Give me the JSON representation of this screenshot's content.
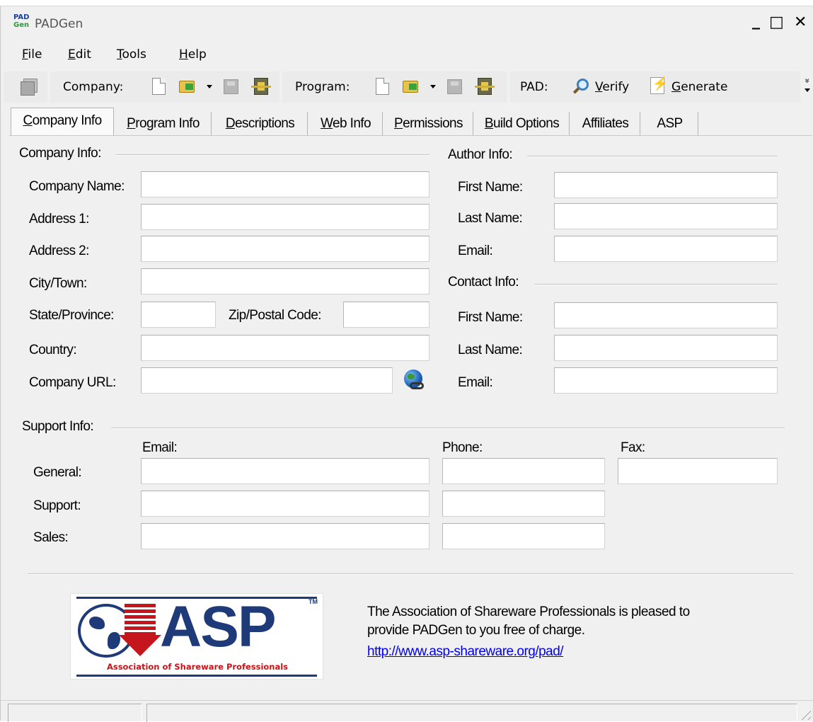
{
  "window": {
    "title": "PADGen",
    "app_icon_top": "PAD",
    "app_icon_bottom": "Gen",
    "minimize": "_",
    "maximize": "□",
    "close": "✕"
  },
  "menu": {
    "file": {
      "key": "F",
      "rest": "ile"
    },
    "edit": {
      "key": "E",
      "rest": "dit"
    },
    "tools": {
      "key": "T",
      "rest": "ools"
    },
    "help": {
      "key": "H",
      "rest": "elp"
    }
  },
  "toolbar": {
    "company_label": "Company:",
    "program_label": "Program:",
    "pad_label": "PAD:",
    "verify": {
      "key": "V",
      "rest": "erify"
    },
    "generate": {
      "key": "G",
      "rest": "enerate"
    },
    "overflow": "»"
  },
  "tabs": [
    {
      "key": "C",
      "rest": "ompany Info",
      "active": true
    },
    {
      "key": "P",
      "rest": "rogram Info"
    },
    {
      "key": "D",
      "rest": "escriptions"
    },
    {
      "key": "W",
      "rest": "eb Info"
    },
    {
      "key": "P",
      "rest": "ermissions"
    },
    {
      "key": "B",
      "rest": "uild Options"
    },
    {
      "key": "",
      "rest": "Affiliates"
    },
    {
      "key": "",
      "rest": "ASP"
    }
  ],
  "company": {
    "group_label": "Company Info:",
    "name_label": "Company Name:",
    "address1_label": "Address 1:",
    "address2_label": "Address 2:",
    "city_label": "City/Town:",
    "state_label": "State/Province:",
    "zip_label": "Zip/Postal Code:",
    "country_label": "Country:",
    "url_label": "Company URL:",
    "name": "",
    "address1": "",
    "address2": "",
    "city": "",
    "state": "",
    "zip": "",
    "country": "",
    "url": ""
  },
  "author": {
    "group_label": "Author Info:",
    "first_label": "First Name:",
    "last_label": "Last Name:",
    "email_label": "Email:",
    "first": "",
    "last": "",
    "email": ""
  },
  "contact": {
    "group_label": "Contact Info:",
    "first_label": "First Name:",
    "last_label": "Last Name:",
    "email_label": "Email:",
    "first": "",
    "last": "",
    "email": ""
  },
  "support": {
    "group_label": "Support Info:",
    "email_header": "Email:",
    "phone_header": "Phone:",
    "fax_header": "Fax:",
    "rows": [
      {
        "label": "General:",
        "email": "",
        "phone": "",
        "fax": ""
      },
      {
        "label": "Support:",
        "email": "",
        "phone": ""
      },
      {
        "label": "Sales:",
        "email": "",
        "phone": ""
      }
    ]
  },
  "footer": {
    "logo_word": "ASP",
    "logo_tm": "TM",
    "logo_sub": "Association of Shareware Professionals",
    "line1": "The Association of Shareware Professionals is pleased to",
    "line2": "provide PADGen to you free of charge.",
    "link": "http://www.asp-shareware.org/pad/"
  },
  "colors": {
    "window_bg": "#f0f0f0",
    "link": "#0000ee",
    "asp_blue": "#1f3a78",
    "asp_red": "#c4161c"
  }
}
